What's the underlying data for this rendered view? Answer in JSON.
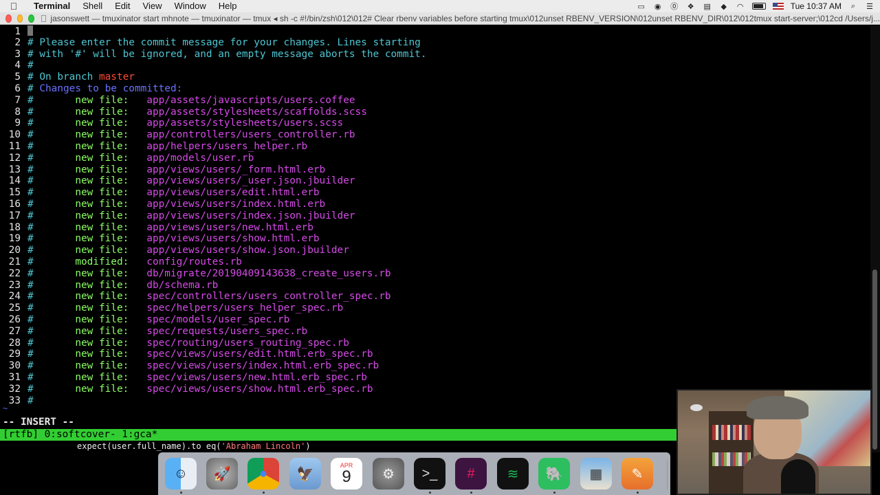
{
  "menubar": {
    "app": "Terminal",
    "menus": [
      "Shell",
      "Edit",
      "View",
      "Window",
      "Help"
    ],
    "clock": "Tue 10:37 AM"
  },
  "titlebar": {
    "title": "jasonswett — tmuxinator start mhnote — tmuxinator — tmux ◂ sh -c #!/bin/zsh\\012\\012# Clear rbenv variables before starting tmux\\012unset RBENV_VERSION\\012unset RBENV_DIR\\012\\012tmux start-server;\\012cd /Users/j..."
  },
  "editor": {
    "header": [
      "Please enter the commit message for your changes. Lines starting",
      "with '#' will be ignored, and an empty message aborts the commit."
    ],
    "branch_prefix": "On branch ",
    "branch": "master",
    "changes_heading": "Changes to be committed:",
    "files": [
      {
        "status": "new file:",
        "path": "app/assets/javascripts/users.coffee"
      },
      {
        "status": "new file:",
        "path": "app/assets/stylesheets/scaffolds.scss"
      },
      {
        "status": "new file:",
        "path": "app/assets/stylesheets/users.scss"
      },
      {
        "status": "new file:",
        "path": "app/controllers/users_controller.rb"
      },
      {
        "status": "new file:",
        "path": "app/helpers/users_helper.rb"
      },
      {
        "status": "new file:",
        "path": "app/models/user.rb"
      },
      {
        "status": "new file:",
        "path": "app/views/users/_form.html.erb"
      },
      {
        "status": "new file:",
        "path": "app/views/users/_user.json.jbuilder"
      },
      {
        "status": "new file:",
        "path": "app/views/users/edit.html.erb"
      },
      {
        "status": "new file:",
        "path": "app/views/users/index.html.erb"
      },
      {
        "status": "new file:",
        "path": "app/views/users/index.json.jbuilder"
      },
      {
        "status": "new file:",
        "path": "app/views/users/new.html.erb"
      },
      {
        "status": "new file:",
        "path": "app/views/users/show.html.erb"
      },
      {
        "status": "new file:",
        "path": "app/views/users/show.json.jbuilder"
      },
      {
        "status": "modified:",
        "path": "config/routes.rb"
      },
      {
        "status": "new file:",
        "path": "db/migrate/20190409143638_create_users.rb"
      },
      {
        "status": "new file:",
        "path": "db/schema.rb"
      },
      {
        "status": "new file:",
        "path": "spec/controllers/users_controller_spec.rb"
      },
      {
        "status": "new file:",
        "path": "spec/helpers/users_helper_spec.rb"
      },
      {
        "status": "new file:",
        "path": "spec/models/user_spec.rb"
      },
      {
        "status": "new file:",
        "path": "spec/requests/users_spec.rb"
      },
      {
        "status": "new file:",
        "path": "spec/routing/users_routing_spec.rb"
      },
      {
        "status": "new file:",
        "path": "spec/views/users/edit.html.erb_spec.rb"
      },
      {
        "status": "new file:",
        "path": "spec/views/users/index.html.erb_spec.rb"
      },
      {
        "status": "new file:",
        "path": "spec/views/users/new.html.erb_spec.rb"
      },
      {
        "status": "new file:",
        "path": "spec/views/users/show.html.erb_spec.rb"
      }
    ],
    "mode": "-- INSERT --",
    "tilde": "~"
  },
  "tmux": {
    "status": "[rtfb] 0:softcover- 1:gca*"
  },
  "background_line": {
    "code": "expect(user.full_name).to eq(",
    "string": "'Abraham Lincoln'",
    "tail": ")"
  },
  "dock": {
    "calendar_month": "APR",
    "calendar_day": "9",
    "apps": [
      "finder-icon",
      "launchpad-icon",
      "chrome-icon",
      "preview-icon",
      "calendar-icon",
      "system-preferences-icon",
      "terminal-icon",
      "slack-icon",
      "spotify-icon",
      "evernote-icon",
      "photos-icon",
      "pages-icon"
    ]
  }
}
